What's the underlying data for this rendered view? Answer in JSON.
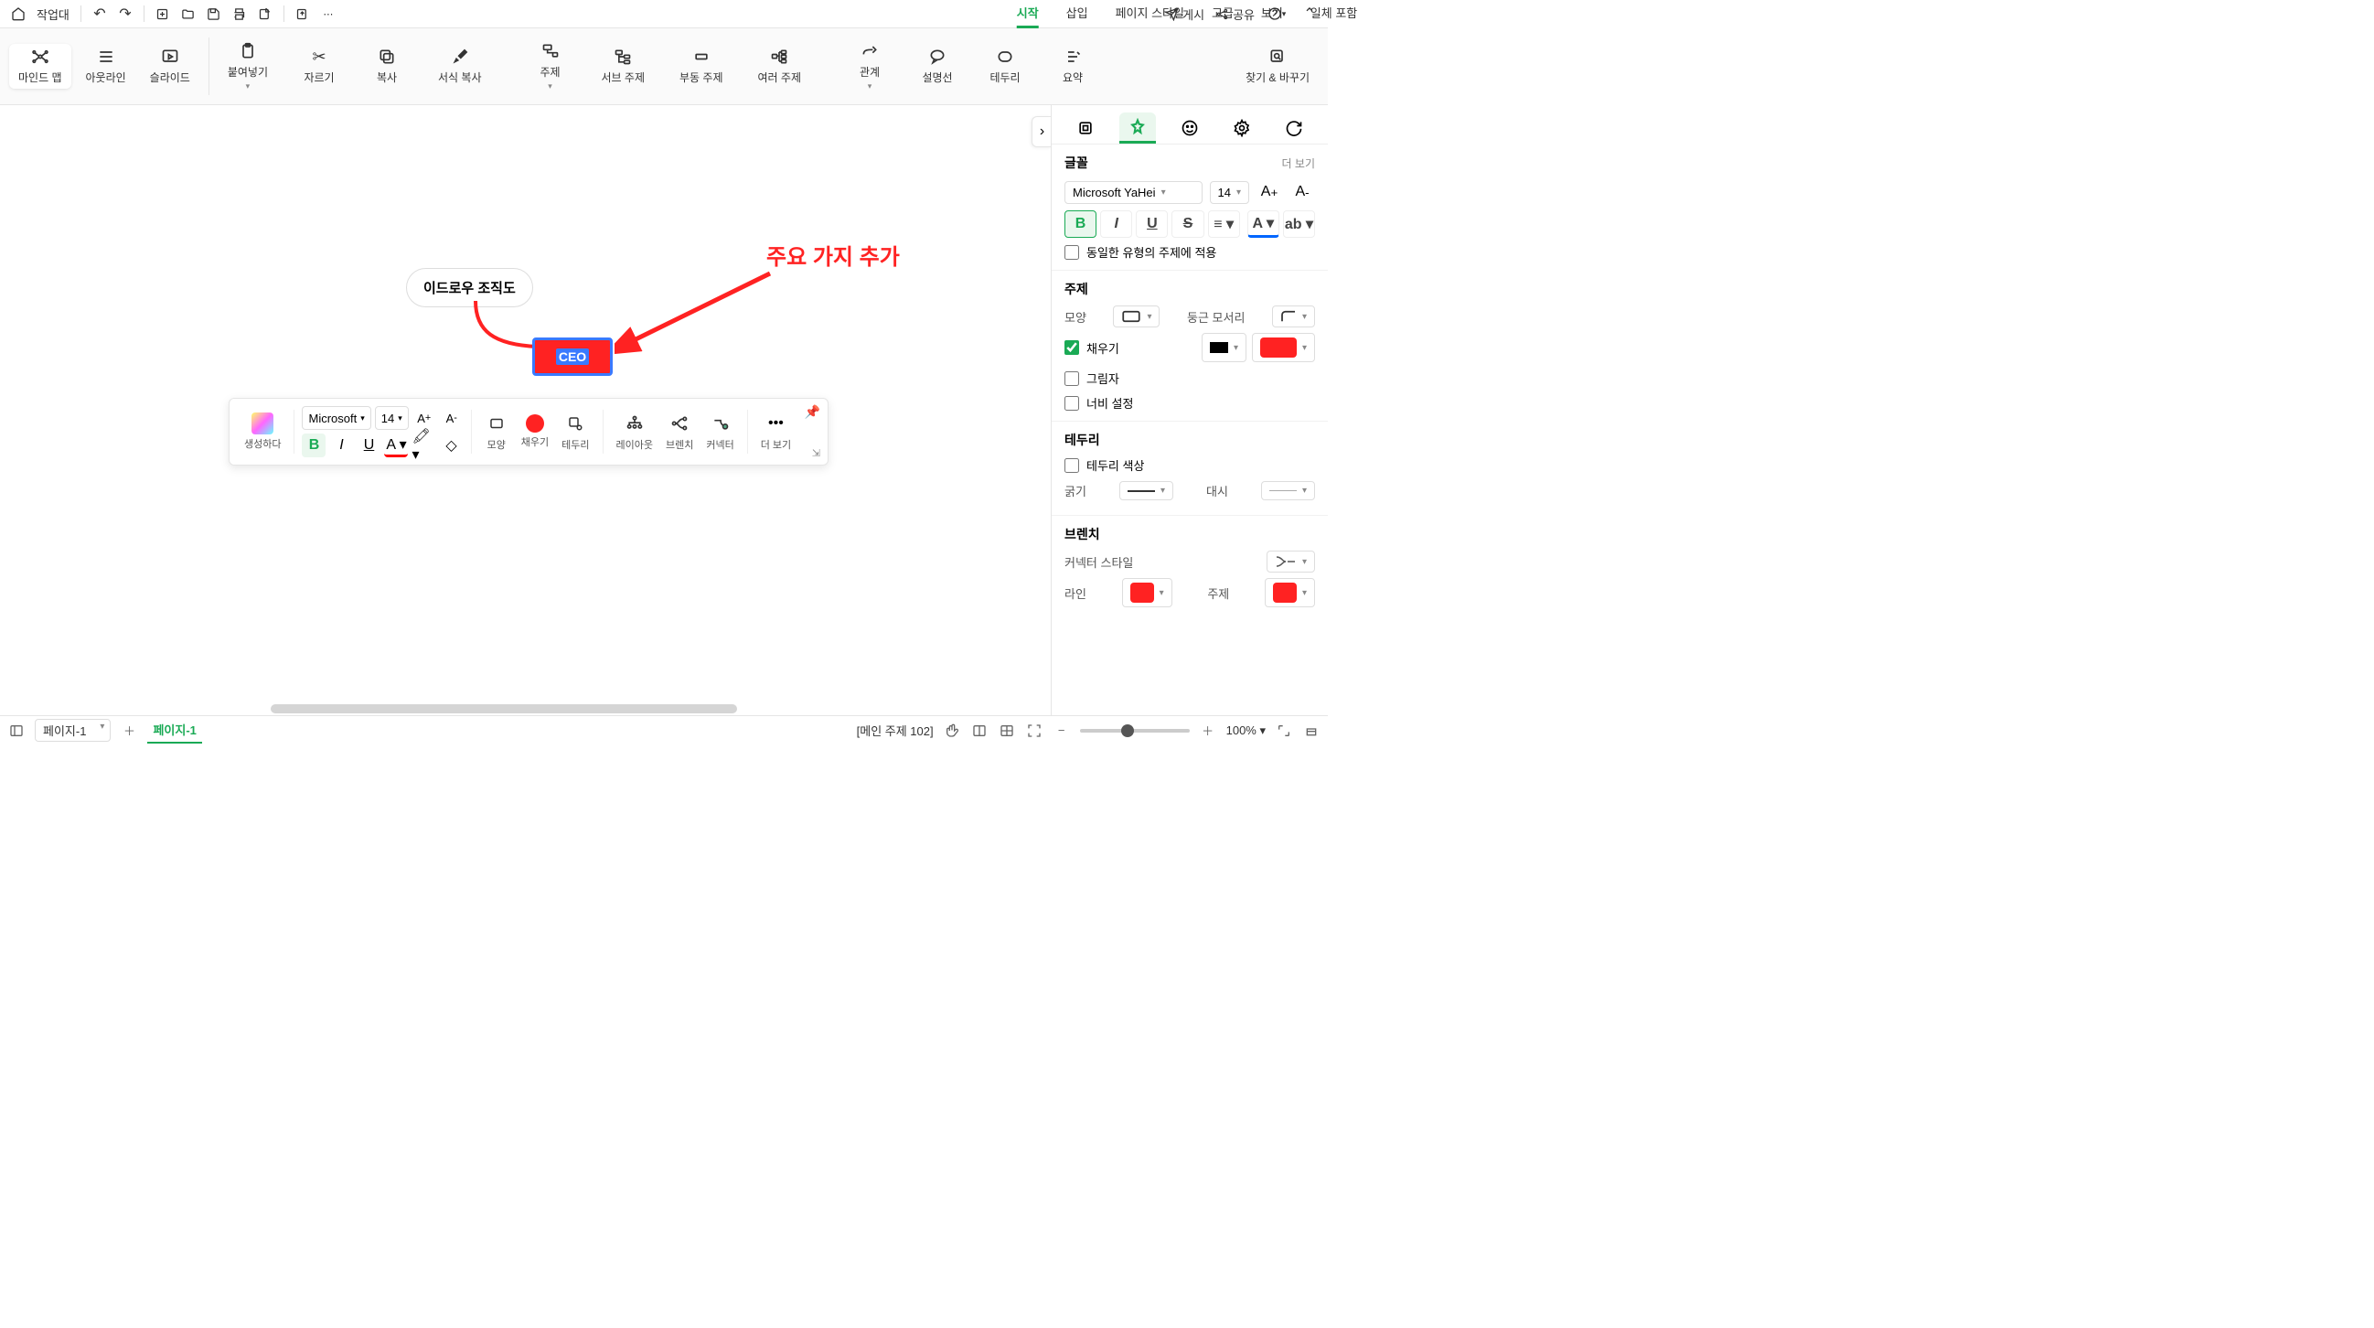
{
  "topbar": {
    "workspace_label": "작업대",
    "publish": "게시",
    "share": "공유"
  },
  "main_tabs": [
    "시작",
    "삽입",
    "페이지 스타일",
    "고급",
    "보기",
    "일체 포함"
  ],
  "active_tab_index": 0,
  "ribbon": {
    "view_modes": [
      {
        "label": "마인드 맵",
        "active": true
      },
      {
        "label": "아웃라인",
        "active": false
      },
      {
        "label": "슬라이드",
        "active": false
      }
    ],
    "actions": [
      "붙여넣기",
      "자르기",
      "복사",
      "서식 복사",
      "주제",
      "서브 주제",
      "부동 주제",
      "여러 주제",
      "관계",
      "설명선",
      "테두리",
      "요약"
    ],
    "find_replace": "찾기 & 바꾸기"
  },
  "canvas": {
    "root_text": "이드로우 조직도",
    "child_text": "CEO",
    "annotation": "주요 가지 추가"
  },
  "float_toolbar": {
    "generate": "생성하다",
    "font": "Microsoft",
    "size": "14",
    "shape": "모양",
    "fill": "채우기",
    "border": "테두리",
    "layout": "레이아웃",
    "branch": "브렌치",
    "connector": "커넥터",
    "more": "더 보기"
  },
  "side": {
    "font_title": "글꼴",
    "more": "더 보기",
    "font_family": "Microsoft YaHei",
    "font_size": "14",
    "apply_same": "동일한 유형의 주제에 적용",
    "topic_title": "주제",
    "shape_label": "모양",
    "corner_label": "둥근 모서리",
    "fill_label": "채우기",
    "shadow_label": "그림자",
    "width_label": "너비 설정",
    "border_title": "테두리",
    "border_color_label": "테두리 색상",
    "thickness_label": "굵기",
    "dash_label": "대시",
    "branch_title": "브렌치",
    "connector_style_label": "커넥터 스타일",
    "line_label": "라인",
    "topic_label": "주제",
    "fill_color": "#f22",
    "line_color": "#f22",
    "topic_color": "#f22"
  },
  "status": {
    "page_selector": "페이지-1",
    "page_tab": "페이지-1",
    "main_info": "[메인 주제 102]",
    "zoom": "100%"
  }
}
